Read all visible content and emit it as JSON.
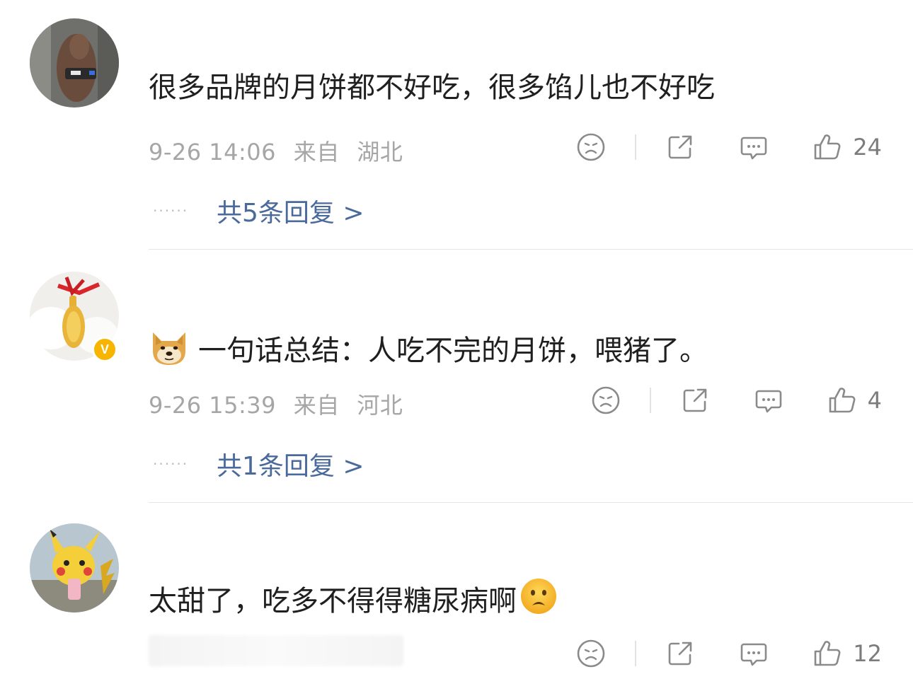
{
  "comments": [
    {
      "text": "很多品牌的月饼都不好吃，很多馅儿也不好吃",
      "date": "9-26 14:06",
      "from_label": "来自",
      "location": "湖北",
      "likes": "24",
      "replies_label": "共5条回复 >",
      "dots": "······"
    },
    {
      "text": "一句话总结：人吃不完的月饼，喂猪了。",
      "date": "9-26 15:39",
      "from_label": "来自",
      "location": "河北",
      "likes": "4",
      "replies_label": "共1条回复 >",
      "dots": "······",
      "leading_emoji": "doge-emoji",
      "verified_badge": "V"
    },
    {
      "text": "太甜了，吃多不得得糖尿病啊",
      "likes": "12",
      "trailing_emoji": "frown-emoji"
    }
  ],
  "icons": [
    "dislike-icon",
    "share-icon",
    "comment-icon",
    "like-icon"
  ],
  "colors": {
    "reply_link": "#4a6a9c",
    "meta_text": "#a6a6a6",
    "badge": "#f7b500"
  }
}
